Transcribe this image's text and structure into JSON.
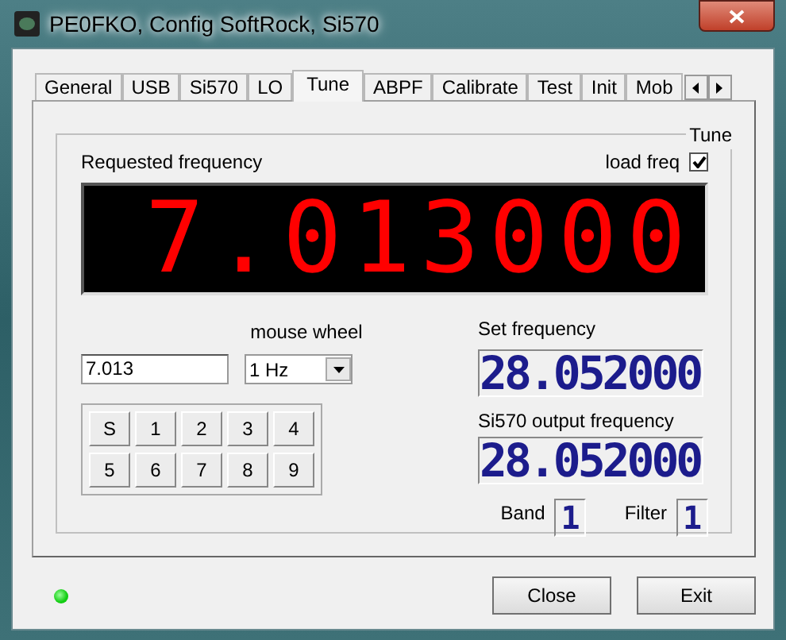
{
  "window": {
    "title": "PE0FKO, Config SoftRock, Si570"
  },
  "tabs": [
    {
      "label": "General",
      "selected": false
    },
    {
      "label": "USB",
      "selected": false
    },
    {
      "label": "Si570",
      "selected": false
    },
    {
      "label": "LO",
      "selected": false
    },
    {
      "label": "Tune",
      "selected": true
    },
    {
      "label": "ABPF",
      "selected": false
    },
    {
      "label": "Calibrate",
      "selected": false
    },
    {
      "label": "Test",
      "selected": false
    },
    {
      "label": "Init",
      "selected": false
    },
    {
      "label": "Mob",
      "selected": false
    }
  ],
  "group": {
    "title": "Tune"
  },
  "requested_frequency": {
    "label": "Requested frequency",
    "display": "7.013000"
  },
  "load_freq": {
    "label": "load freq",
    "checked": true
  },
  "frequency_field": {
    "value": "7.013"
  },
  "mouse_wheel": {
    "label": "mouse wheel",
    "value": "1 Hz"
  },
  "keypad": [
    "S",
    "1",
    "2",
    "3",
    "4",
    "5",
    "6",
    "7",
    "8",
    "9"
  ],
  "set_frequency": {
    "label": "Set frequency",
    "display": "28.052000"
  },
  "output_frequency": {
    "label": "Si570 output frequency",
    "display": "28.052000"
  },
  "band": {
    "label": "Band",
    "display": "1"
  },
  "filter": {
    "label": "Filter",
    "display": "1"
  },
  "status_led": {
    "on": true
  },
  "buttons": [
    "Close",
    "Exit"
  ]
}
